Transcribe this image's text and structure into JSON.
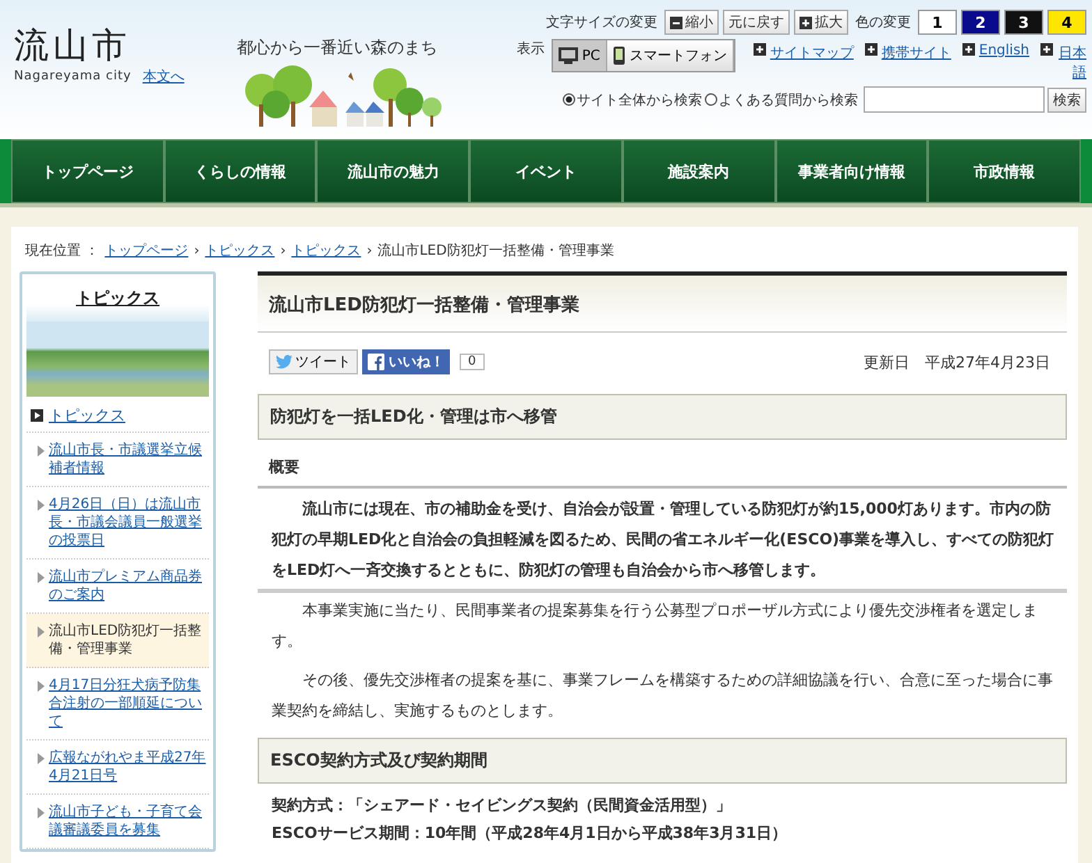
{
  "header": {
    "logo": "流山市",
    "logo_sub": "Nagareyama city",
    "skip_link": "本文へ",
    "tagline": "都心から一番近い森のまち",
    "font_size": {
      "label": "文字サイズの変更",
      "buttons": [
        {
          "label": "縮小",
          "kind": "minus"
        },
        {
          "label": "元に戻す",
          "kind": "plain"
        },
        {
          "label": "拡大",
          "kind": "plus"
        }
      ]
    },
    "color_change": {
      "label": "色の変更",
      "options": [
        {
          "label": "1",
          "color": "#ffffff"
        },
        {
          "label": "2",
          "color": "#0a0a8c"
        },
        {
          "label": "3",
          "color": "#111111"
        },
        {
          "label": "4",
          "color": "#ffe600"
        }
      ]
    },
    "display": {
      "label": "表示",
      "options": [
        {
          "label": "PC",
          "kind": "pc",
          "selected": true
        },
        {
          "label": "スマートフォン",
          "kind": "phone",
          "selected": false
        }
      ]
    },
    "links": [
      "サイトマップ",
      "携帯サイト",
      "English",
      "日本語"
    ],
    "search": {
      "scopes": [
        {
          "label": "サイト全体から検索",
          "selected": true
        },
        {
          "label": "よくある質問から検索",
          "selected": false
        }
      ],
      "button": "検索"
    }
  },
  "nav": [
    "トップページ",
    "くらしの情報",
    "流山市の魅力",
    "イベント",
    "施設案内",
    "事業者向け情報",
    "市政情報"
  ],
  "breadcrumb": {
    "label": "現在位置 ：",
    "links": [
      {
        "label": "トップページ",
        "separator": "›"
      },
      {
        "label": "トピックス",
        "separator": "›"
      },
      {
        "label": "トピックス",
        "separator": "›"
      }
    ],
    "current": "流山市LED防犯灯一括整備・管理事業"
  },
  "sidebar": {
    "title": "トピックス",
    "section": "トピックス",
    "items": [
      {
        "label": "流山市長・市議選挙立候補者情報",
        "selected": false
      },
      {
        "label": "4月26日（日）は流山市長・市議会議員一般選挙の投票日",
        "selected": false
      },
      {
        "label": "流山市プレミアム商品券のご案内",
        "selected": false
      },
      {
        "label": "流山市LED防犯灯一括整備・管理事業",
        "selected": true
      },
      {
        "label": "4月17日分狂犬病予防集合注射の一部順延について",
        "selected": false
      },
      {
        "label": "広報ながれやま平成27年4月21日号",
        "selected": false
      },
      {
        "label": "流山市子ども・子育て会議審議委員を募集",
        "selected": false
      }
    ]
  },
  "article": {
    "title": "流山市LED防犯灯一括整備・管理事業",
    "tweet": "ツイート",
    "like": "いいね！",
    "like_count": "0",
    "updated": "更新日　平成27年4月23日",
    "sections": [
      {
        "kind": "heading",
        "text": "防犯灯を一括LED化・管理は市へ移管"
      },
      {
        "kind": "subheading",
        "text": "概要"
      },
      {
        "kind": "lead",
        "text": "流山市には現在、市の補助金を受け、自治会が設置・管理している防犯灯が約15,000灯あります。市内の防犯灯の早期LED化と自治会の負担軽減を図るため、民間の省エネルギー化(ESCO)事業を導入し、すべての防犯灯をLED灯へ一斉交換するとともに、防犯灯の管理も自治会から市へ移管します。"
      },
      {
        "kind": "para",
        "text": "本事業実施に当たり、民間事業者の提案募集を行う公募型プロポーザル方式により優先交渉権者を選定します。"
      },
      {
        "kind": "para",
        "text": "その後、優先交渉権者の提案を基に、事業フレームを構築するための詳細協議を行い、合意に至った場合に事業契約を締結し、実施するものとします。"
      },
      {
        "kind": "heading",
        "text": "ESCO契約方式及び契約期間"
      },
      {
        "kind": "line",
        "text": "契約方式：「シェアード・セイビングス契約（民間資金活用型）」"
      },
      {
        "kind": "line",
        "text": "ESCOサービス期間：10年間（平成28年4月1日から平成38年3月31日）"
      }
    ]
  }
}
